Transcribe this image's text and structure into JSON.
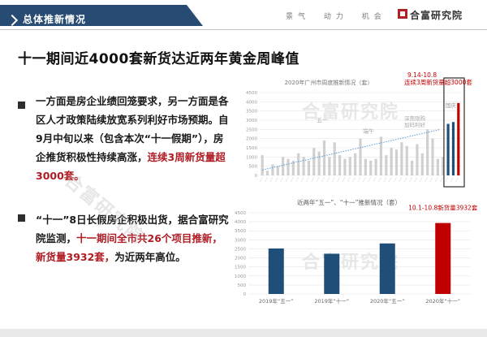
{
  "header": {
    "title": "总体推新情况",
    "tags": [
      "景气",
      "动力",
      "机会"
    ],
    "brand": "合富研究院"
  },
  "headline": "十一期间近4000套新货达近两年黄金周峰值",
  "para1": {
    "text_a": "一方面是房企业绩回笼要求，另一方面是各区人才政策陆续放宽系列利好市场预期。自9月中旬以来（包含本次“十一假期”），房企推货积极性持续高涨，",
    "text_red": "连续3周新货量超3000套。"
  },
  "para2": {
    "text_a": "“十一”8日长假房企积极出货，据合富研究院监测，",
    "text_red": "十一期间全市共26个项目推新，新货量3932套，",
    "text_b": "为近两年高位。"
  },
  "watermark": "合富研究院",
  "chart_data": [
    {
      "type": "bar",
      "title": "2020年广州市周度推新情况（套）",
      "ylim": [
        0,
        4500
      ],
      "yticks": [
        0,
        500,
        1000,
        1500,
        2000,
        2500,
        3000,
        3500,
        4000,
        4500
      ],
      "grid": true,
      "values": [
        1100,
        250,
        600,
        500,
        1000,
        900,
        800,
        1200,
        1000,
        800,
        1500,
        1300,
        1900,
        1000,
        1800,
        1100,
        900,
        1000,
        1200,
        2000,
        900,
        800,
        900,
        2100,
        1100,
        1500,
        1400,
        1800,
        1600,
        800,
        1700,
        1200,
        2500,
        2000,
        900,
        1000,
        2800,
        2900,
        3932
      ],
      "highlight_last": 3,
      "trend": {
        "start": 300,
        "end": 2500
      },
      "annotations": [
        "五一",
        "端午",
        "深莞限购\n加码利好"
      ],
      "callout": {
        "line1": "9.14-10.8",
        "line2": "连续3周新货量超3000套"
      },
      "extra_label": "国庆"
    },
    {
      "type": "bar",
      "title": "近两年“五一”、“十一”推新情况（套）",
      "categories": [
        "2019年“五一”",
        "2019年“十一”",
        "2020年“五一”",
        "2020年“十一”"
      ],
      "values": [
        2520,
        2230,
        2800,
        3932
      ],
      "ylim": [
        0,
        4500
      ],
      "yticks": [
        0,
        500,
        1000,
        1500,
        2000,
        2500,
        3000,
        3500,
        4000,
        4500
      ],
      "grid": true,
      "highlight_index": 3,
      "callout": "10.1-10.8新货量3932套"
    }
  ],
  "colors": {
    "navy": "#1f4e79",
    "red": "#c00000",
    "grey_bar": "#d0d0d0",
    "trend": "#5b9bd5",
    "header": "#274b73",
    "callout_text": "#c00000"
  }
}
